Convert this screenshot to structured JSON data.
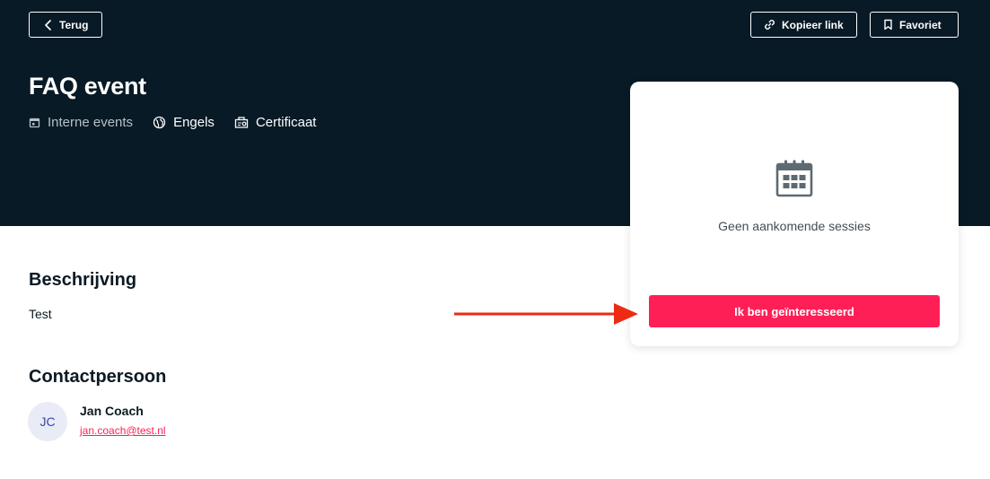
{
  "header": {
    "back_label": "Terug",
    "copy_link_label": "Kopieer link",
    "favorite_label": "Favoriet"
  },
  "event": {
    "title": "FAQ event",
    "meta": {
      "type": "Interne events",
      "language": "Engels",
      "certificate": "Certificaat"
    }
  },
  "sessions_card": {
    "empty_text": "Geen aankomende sessies",
    "cta_label": "Ik ben geïnteresseerd"
  },
  "description": {
    "heading": "Beschrijving",
    "text": "Test"
  },
  "contact": {
    "heading": "Contactpersoon",
    "initials": "JC",
    "name": "Jan Coach",
    "email": "jan.coach@test.nl"
  },
  "colors": {
    "hero_bg": "#081a26",
    "accent": "#ff1f57",
    "annotation_arrow": "#ee2a14"
  },
  "icons": {
    "back": "chevron-left-icon",
    "copy_link": "link-icon",
    "favorite": "bookmark-icon",
    "event_type": "calendar-small-icon",
    "language": "globe-icon",
    "certificate": "certificate-icon",
    "empty_sessions": "calendar-icon",
    "annotation": "arrow-right-icon"
  }
}
